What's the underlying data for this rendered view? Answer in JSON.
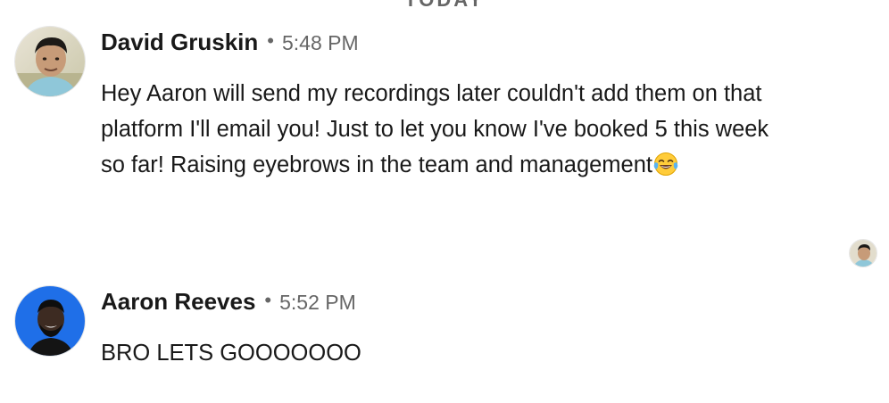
{
  "divider": {
    "label": "TODAY"
  },
  "messages": [
    {
      "sender": "David Gruskin",
      "separator": "•",
      "time": "5:48 PM",
      "text": "Hey Aaron will send my recordings later couldn't add them on that platform I'll email you! Just to let you know I've booked 5 this week so far! Raising eyebrows in the team and management",
      "emoji_icon": "face-with-tears-of-joy-icon"
    },
    {
      "sender": "Aaron Reeves",
      "separator": "•",
      "time": "5:52 PM",
      "text": "BRO LETS GOOOOOOO"
    }
  ],
  "colors": {
    "text_primary": "#191919",
    "text_secondary": "#666666",
    "aaron_avatar_bg": "#1f6fe8"
  }
}
